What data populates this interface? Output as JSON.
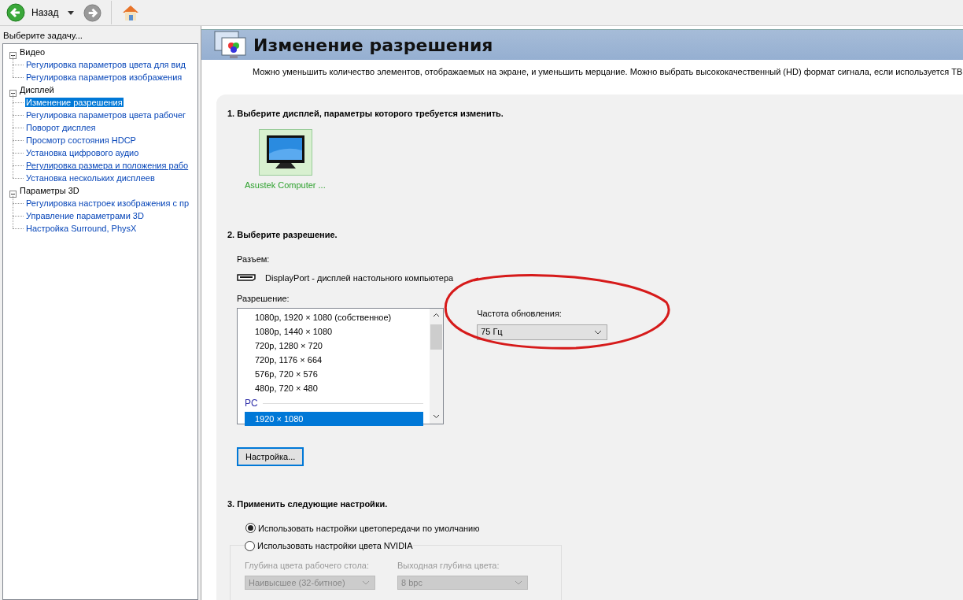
{
  "toolbar": {
    "back_label": "Назад"
  },
  "sidebar": {
    "title": "Выберите задачу...",
    "tree": [
      {
        "label": "Видео",
        "expanded": true,
        "children": [
          {
            "label": "Регулировка параметров цвета для вид",
            "selected": false,
            "hovered": false
          },
          {
            "label": "Регулировка параметров изображения",
            "selected": false,
            "hovered": false
          }
        ]
      },
      {
        "label": "Дисплей",
        "expanded": true,
        "children": [
          {
            "label": "Изменение разрешения",
            "selected": true,
            "hovered": false
          },
          {
            "label": "Регулировка параметров цвета рабочег",
            "selected": false,
            "hovered": false
          },
          {
            "label": "Поворот дисплея",
            "selected": false,
            "hovered": false
          },
          {
            "label": "Просмотр состояния HDCP",
            "selected": false,
            "hovered": false
          },
          {
            "label": "Установка цифрового аудио",
            "selected": false,
            "hovered": false
          },
          {
            "label": "Регулировка размера и положения рабо",
            "selected": false,
            "hovered": true
          },
          {
            "label": "Установка нескольких дисплеев",
            "selected": false,
            "hovered": false
          }
        ]
      },
      {
        "label": "Параметры 3D",
        "expanded": true,
        "children": [
          {
            "label": "Регулировка настроек изображения с пр",
            "selected": false,
            "hovered": false
          },
          {
            "label": "Управление параметрами 3D",
            "selected": false,
            "hovered": false
          },
          {
            "label": "Настройка Surround, PhysX",
            "selected": false,
            "hovered": false
          }
        ]
      }
    ]
  },
  "page": {
    "title": "Изменение разрешения",
    "description": "Можно уменьшить количество элементов, отображаемых на экране, и уменьшить мерцание. Можно выбрать высококачественный (HD) формат сигнала, если используется ТВ"
  },
  "step1": {
    "heading": "1. Выберите дисплей, параметры которого требуется изменить.",
    "displays": [
      {
        "label": "Asustek Computer ...",
        "selected": true
      }
    ]
  },
  "step2": {
    "heading": "2. Выберите разрешение.",
    "connector_label": "Разъем:",
    "connector": "DisplayPort - дисплей настольного компьютера",
    "resolution_label": "Разрешение:",
    "resolutions": [
      {
        "kind": "item",
        "label": "1080p, 1920 × 1080 (собственное)",
        "selected": false
      },
      {
        "kind": "item",
        "label": "1080p, 1440 × 1080",
        "selected": false
      },
      {
        "kind": "item",
        "label": "720p, 1280 × 720",
        "selected": false
      },
      {
        "kind": "item",
        "label": "720p, 1176 × 664",
        "selected": false
      },
      {
        "kind": "item",
        "label": "576p, 720 × 576",
        "selected": false
      },
      {
        "kind": "item",
        "label": "480p, 720 × 480",
        "selected": false
      },
      {
        "kind": "group",
        "label": "PC"
      },
      {
        "kind": "item",
        "label": "1920 × 1080",
        "selected": true
      }
    ],
    "refresh_label": "Частота обновления:",
    "refresh_value": "75 Гц",
    "customize_button": "Настройка..."
  },
  "step3": {
    "heading": "3. Применить следующие настройки.",
    "options": [
      {
        "label": "Использовать настройки цветопередачи по умолчанию",
        "selected": true
      },
      {
        "label": "Использовать настройки цвета NVIDIA",
        "selected": false
      }
    ],
    "fields": [
      {
        "label": "Глубина цвета рабочего стола:",
        "value": "Наивысшее (32-битное)",
        "disabled": true
      },
      {
        "label": "Выходная глубина цвета:",
        "value": "8 bpc",
        "disabled": true
      }
    ]
  }
}
